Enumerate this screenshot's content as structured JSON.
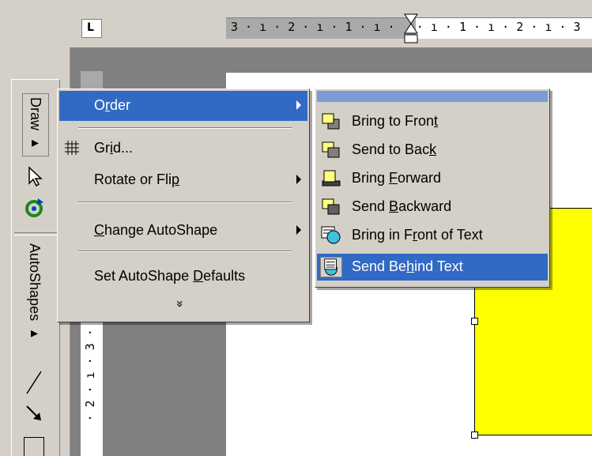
{
  "ruler": {
    "corner_label": "L",
    "top_text": "3 · ı · 2 · ı · 1 · ı ·   · ı · 1 · ı · 2 · ı · 3",
    "left_text": "· 2 · ı · 3 · ı ·"
  },
  "draw_toolbar": {
    "draw_label": "Draw ▸",
    "autoshapes_label": "AutoShapes ▸"
  },
  "menu": {
    "items": [
      {
        "pre": "O",
        "u": "r",
        "post": "der",
        "submenu": true,
        "highlighted": true
      },
      {
        "pre": "Gr",
        "u": "i",
        "post": "d...",
        "icon": "grid-icon"
      },
      {
        "pre": "Rotate or Fli",
        "u": "p",
        "post": "",
        "submenu": true
      },
      {
        "pre": "",
        "u": "C",
        "post": "hange AutoShape",
        "submenu": true
      },
      {
        "pre": "Set AutoShape ",
        "u": "D",
        "post": "efaults"
      }
    ],
    "expand_label": "»"
  },
  "submenu": {
    "items": [
      {
        "pre": "Bring to Fron",
        "u": "t",
        "post": "",
        "icon": "bring-to-front-icon"
      },
      {
        "pre": "Send to Bac",
        "u": "k",
        "post": "",
        "icon": "send-to-back-icon"
      },
      {
        "pre": "Bring ",
        "u": "F",
        "post": "orward",
        "icon": "bring-forward-icon"
      },
      {
        "pre": "Send ",
        "u": "B",
        "post": "ackward",
        "icon": "send-backward-icon"
      },
      {
        "pre": "Bring in F",
        "u": "r",
        "post": "ont of Text",
        "icon": "bring-in-front-of-text-icon"
      },
      {
        "pre": "Send Be",
        "u": "h",
        "post": "ind Text",
        "icon": "send-behind-text-icon",
        "highlighted": true
      }
    ]
  },
  "colors": {
    "highlight": "#316ac5",
    "menu_bg": "#d4d0c8",
    "shape_fill": "#ffff00"
  }
}
